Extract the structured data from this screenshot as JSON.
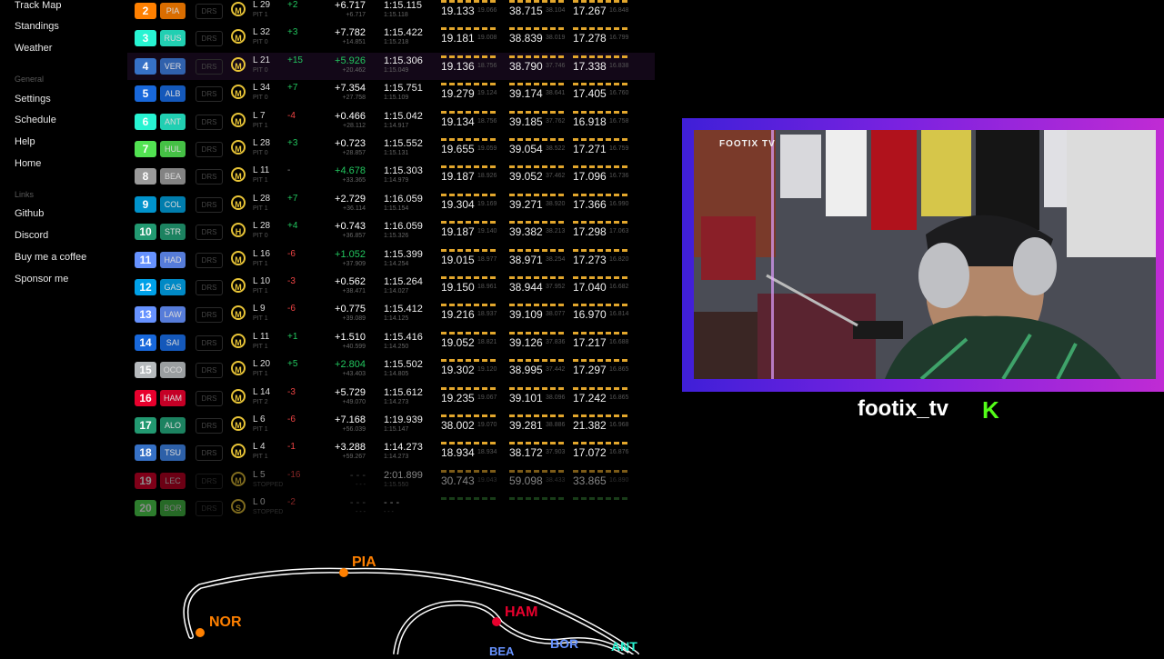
{
  "sidebar": {
    "top_items": [
      "Track Map",
      "Standings",
      "Weather"
    ],
    "general_label": "General",
    "general_items": [
      "Settings",
      "Schedule",
      "Help",
      "Home"
    ],
    "links_label": "Links",
    "links_items": [
      "Github",
      "Discord",
      "Buy me a coffee",
      "Sponsor me"
    ]
  },
  "drs_label": "DRS",
  "rows": [
    {
      "pos": "2",
      "code": "PIA",
      "team_color": "#ff8000",
      "tyre": "M",
      "lap": "L 29",
      "pit": "PIT 1",
      "gain": "+2",
      "gain_color": "#22c55e",
      "gap": "+6.717",
      "gap2": "+6.717",
      "gap_color": "#ffffff",
      "lt": "1:15.115",
      "lt2": "1:15.118",
      "s1": "19.133",
      "s1b": "19.066",
      "s2": "38.715",
      "s2b": "38.104",
      "s3": "17.267",
      "s3b": "16.848"
    },
    {
      "pos": "3",
      "code": "RUS",
      "team_color": "#27f4d2",
      "tyre": "M",
      "lap": "L 32",
      "pit": "PIT 0",
      "gain": "+3",
      "gain_color": "#22c55e",
      "gap": "+7.782",
      "gap2": "+14.851",
      "gap_color": "#ffffff",
      "lt": "1:15.422",
      "lt2": "1:15.218",
      "s1": "19.181",
      "s1b": "19.008",
      "s2": "38.839",
      "s2b": "38.019",
      "s3": "17.278",
      "s3b": "16.799"
    },
    {
      "pos": "4",
      "code": "VER",
      "team_color": "#3671c6",
      "tyre": "M",
      "lap": "L 21",
      "pit": "PIT 0",
      "gain": "+15",
      "gain_color": "#22c55e",
      "gap": "+5.926",
      "gap2": "+20.462",
      "gap_color": "#22c55e",
      "lt": "1:15.306",
      "lt2": "1:15.049",
      "s1": "19.136",
      "s1b": "18.756",
      "s2": "38.790",
      "s2b": "37.746",
      "s3": "17.338",
      "s3b": "16.838",
      "hl": true
    },
    {
      "pos": "5",
      "code": "ALB",
      "team_color": "#1868db",
      "tyre": "M",
      "lap": "L 34",
      "pit": "PIT 0",
      "gain": "+7",
      "gain_color": "#22c55e",
      "gap": "+7.354",
      "gap2": "+27.758",
      "gap_color": "#ffffff",
      "lt": "1:15.751",
      "lt2": "1:15.109",
      "s1": "19.279",
      "s1b": "19.124",
      "s2": "39.174",
      "s2b": "38.641",
      "s3": "17.405",
      "s3b": "16.760"
    },
    {
      "pos": "6",
      "code": "ANT",
      "team_color": "#27f4d2",
      "tyre": "M",
      "lap": "L 7",
      "pit": "PIT 1",
      "gain": "-4",
      "gain_color": "#ef4444",
      "gap": "+0.466",
      "gap2": "+28.112",
      "gap_color": "#ffffff",
      "lt": "1:15.042",
      "lt2": "1:14.917",
      "s1": "19.134",
      "s1b": "18.756",
      "s2": "39.185",
      "s2b": "37.762",
      "s3": "16.918",
      "s3b": "16.758"
    },
    {
      "pos": "7",
      "code": "HUL",
      "team_color": "#52e252",
      "tyre": "M",
      "lap": "L 28",
      "pit": "PIT 0",
      "gain": "+3",
      "gain_color": "#22c55e",
      "gap": "+0.723",
      "gap2": "+28.857",
      "gap_color": "#ffffff",
      "lt": "1:15.552",
      "lt2": "1:15.131",
      "s1": "19.655",
      "s1b": "19.059",
      "s2": "39.054",
      "s2b": "38.522",
      "s3": "17.271",
      "s3b": "16.759"
    },
    {
      "pos": "8",
      "code": "BEA",
      "team_color": "#9a9a9a",
      "tyre": "M",
      "lap": "L 11",
      "pit": "PIT 1",
      "gain": "-",
      "gain_color": "#888888",
      "gap": "+4.678",
      "gap2": "+33.365",
      "gap_color": "#22c55e",
      "lt": "1:15.303",
      "lt2": "1:14.979",
      "s1": "19.187",
      "s1b": "18.926",
      "s2": "39.052",
      "s2b": "37.462",
      "s3": "17.096",
      "s3b": "16.736"
    },
    {
      "pos": "9",
      "code": "COL",
      "team_color": "#0093cc",
      "tyre": "M",
      "lap": "L 28",
      "pit": "PIT 1",
      "gain": "+7",
      "gain_color": "#22c55e",
      "gap": "+2.729",
      "gap2": "+36.114",
      "gap_color": "#ffffff",
      "lt": "1:16.059",
      "lt2": "1:15.154",
      "s1": "19.304",
      "s1b": "19.169",
      "s2": "39.271",
      "s2b": "38.920",
      "s3": "17.366",
      "s3b": "16.990"
    },
    {
      "pos": "10",
      "code": "STR",
      "team_color": "#229971",
      "tyre": "H",
      "lap": "L 28",
      "pit": "PIT 0",
      "gain": "+4",
      "gain_color": "#22c55e",
      "gap": "+0.743",
      "gap2": "+36.857",
      "gap_color": "#ffffff",
      "lt": "1:16.059",
      "lt2": "1:15.326",
      "s1": "19.187",
      "s1b": "19.140",
      "s2": "39.382",
      "s2b": "38.213",
      "s3": "17.298",
      "s3b": "17.063"
    },
    {
      "pos": "11",
      "code": "HAD",
      "team_color": "#6692ff",
      "tyre": "M",
      "lap": "L 16",
      "pit": "PIT 1",
      "gain": "-6",
      "gain_color": "#ef4444",
      "gap": "+1.052",
      "gap2": "+37.909",
      "gap_color": "#22c55e",
      "lt": "1:15.399",
      "lt2": "1:14.254",
      "s1": "19.015",
      "s1b": "18.977",
      "s2": "38.971",
      "s2b": "38.254",
      "s3": "17.273",
      "s3b": "16.820"
    },
    {
      "pos": "12",
      "code": "GAS",
      "team_color": "#00a1e8",
      "tyre": "M",
      "lap": "L 10",
      "pit": "PIT 1",
      "gain": "-3",
      "gain_color": "#ef4444",
      "gap": "+0.562",
      "gap2": "+38.471",
      "gap_color": "#ffffff",
      "lt": "1:15.264",
      "lt2": "1:14.027",
      "s1": "19.150",
      "s1b": "18.961",
      "s2": "38.944",
      "s2b": "37.952",
      "s3": "17.040",
      "s3b": "16.682"
    },
    {
      "pos": "13",
      "code": "LAW",
      "team_color": "#6692ff",
      "tyre": "M",
      "lap": "L 9",
      "pit": "PIT 1",
      "gain": "-6",
      "gain_color": "#ef4444",
      "gap": "+0.775",
      "gap2": "+39.089",
      "gap_color": "#ffffff",
      "lt": "1:15.412",
      "lt2": "1:14.125",
      "s1": "19.216",
      "s1b": "18.937",
      "s2": "39.109",
      "s2b": "38.077",
      "s3": "16.970",
      "s3b": "16.814"
    },
    {
      "pos": "14",
      "code": "SAI",
      "team_color": "#1868db",
      "tyre": "M",
      "lap": "L 11",
      "pit": "PIT 1",
      "gain": "+1",
      "gain_color": "#22c55e",
      "gap": "+1.510",
      "gap2": "+40.599",
      "gap_color": "#ffffff",
      "lt": "1:15.416",
      "lt2": "1:14.250",
      "s1": "19.052",
      "s1b": "18.821",
      "s2": "39.126",
      "s2b": "37.836",
      "s3": "17.217",
      "s3b": "16.688"
    },
    {
      "pos": "15",
      "code": "OCO",
      "team_color": "#b6babd",
      "tyre": "M",
      "lap": "L 20",
      "pit": "PIT 1",
      "gain": "+5",
      "gain_color": "#22c55e",
      "gap": "+2.804",
      "gap2": "+43.403",
      "gap_color": "#22c55e",
      "lt": "1:15.502",
      "lt2": "1:14.805",
      "s1": "19.302",
      "s1b": "19.120",
      "s2": "38.995",
      "s2b": "37.442",
      "s3": "17.297",
      "s3b": "16.865"
    },
    {
      "pos": "16",
      "code": "HAM",
      "team_color": "#e8002d",
      "tyre": "M",
      "lap": "L 14",
      "pit": "PIT 2",
      "gain": "-3",
      "gain_color": "#ef4444",
      "gap": "+5.729",
      "gap2": "+49.070",
      "gap_color": "#ffffff",
      "lt": "1:15.612",
      "lt2": "1:14.273",
      "s1": "19.235",
      "s1b": "19.067",
      "s2": "39.101",
      "s2b": "38.096",
      "s3": "17.242",
      "s3b": "16.865"
    },
    {
      "pos": "17",
      "code": "ALO",
      "team_color": "#229971",
      "tyre": "M",
      "lap": "L 6",
      "pit": "PIT 1",
      "gain": "-6",
      "gain_color": "#ef4444",
      "gap": "+7.168",
      "gap2": "+56.039",
      "gap_color": "#ffffff",
      "lt": "1:19.939",
      "lt2": "1:15.147",
      "s1": "38.002",
      "s1b": "19.070",
      "s2": "39.281",
      "s2b": "38.886",
      "s3": "21.382",
      "s3b": "16.968"
    },
    {
      "pos": "18",
      "code": "TSU",
      "team_color": "#3671c6",
      "tyre": "M",
      "lap": "L 4",
      "pit": "PIT 1",
      "gain": "-1",
      "gain_color": "#ef4444",
      "gap": "+3.288",
      "gap2": "+59.267",
      "gap_color": "#ffffff",
      "lt": "1:14.273",
      "lt2": "1:14.273",
      "s1": "18.934",
      "s1b": "18.934",
      "s2": "38.172",
      "s2b": "37.903",
      "s3": "17.072",
      "s3b": "16.876"
    },
    {
      "pos": "19",
      "code": "LEC",
      "team_color": "#e8002d",
      "tyre": "M",
      "lap": "L 5",
      "pit": "STOPPED",
      "gain": "-16",
      "gain_color": "#ef4444",
      "gap": "- - -",
      "gap2": "- - -",
      "gap_color": "#777777",
      "lt": "2:01.899",
      "lt2": "1:15.550",
      "s1": "30.743",
      "s1b": "19.043",
      "s2": "59.098",
      "s2b": "38.433",
      "s3": "33.865",
      "s3b": "16.890",
      "dim": true
    },
    {
      "pos": "20",
      "code": "BOR",
      "team_color": "#52e252",
      "tyre": "S",
      "lap": "L 0",
      "pit": "STOPPED",
      "gain": "-2",
      "gain_color": "#ef4444",
      "gap": "- - -",
      "gap2": "- - -",
      "gap_color": "#777777",
      "lt": "- - -",
      "lt2": "- - -",
      "s1": "",
      "s1b": "",
      "s2": "",
      "s2b": "",
      "s3": "",
      "s3b": "",
      "dim": true
    }
  ],
  "stream": {
    "name": "footix_tv",
    "platform_logo": "K",
    "logo_text": "FOOTIX TV",
    "accent": "#53fc18"
  },
  "track_labels": [
    "PIA",
    "NOR",
    "HAM",
    "BOR",
    "ANT",
    "BEA"
  ]
}
